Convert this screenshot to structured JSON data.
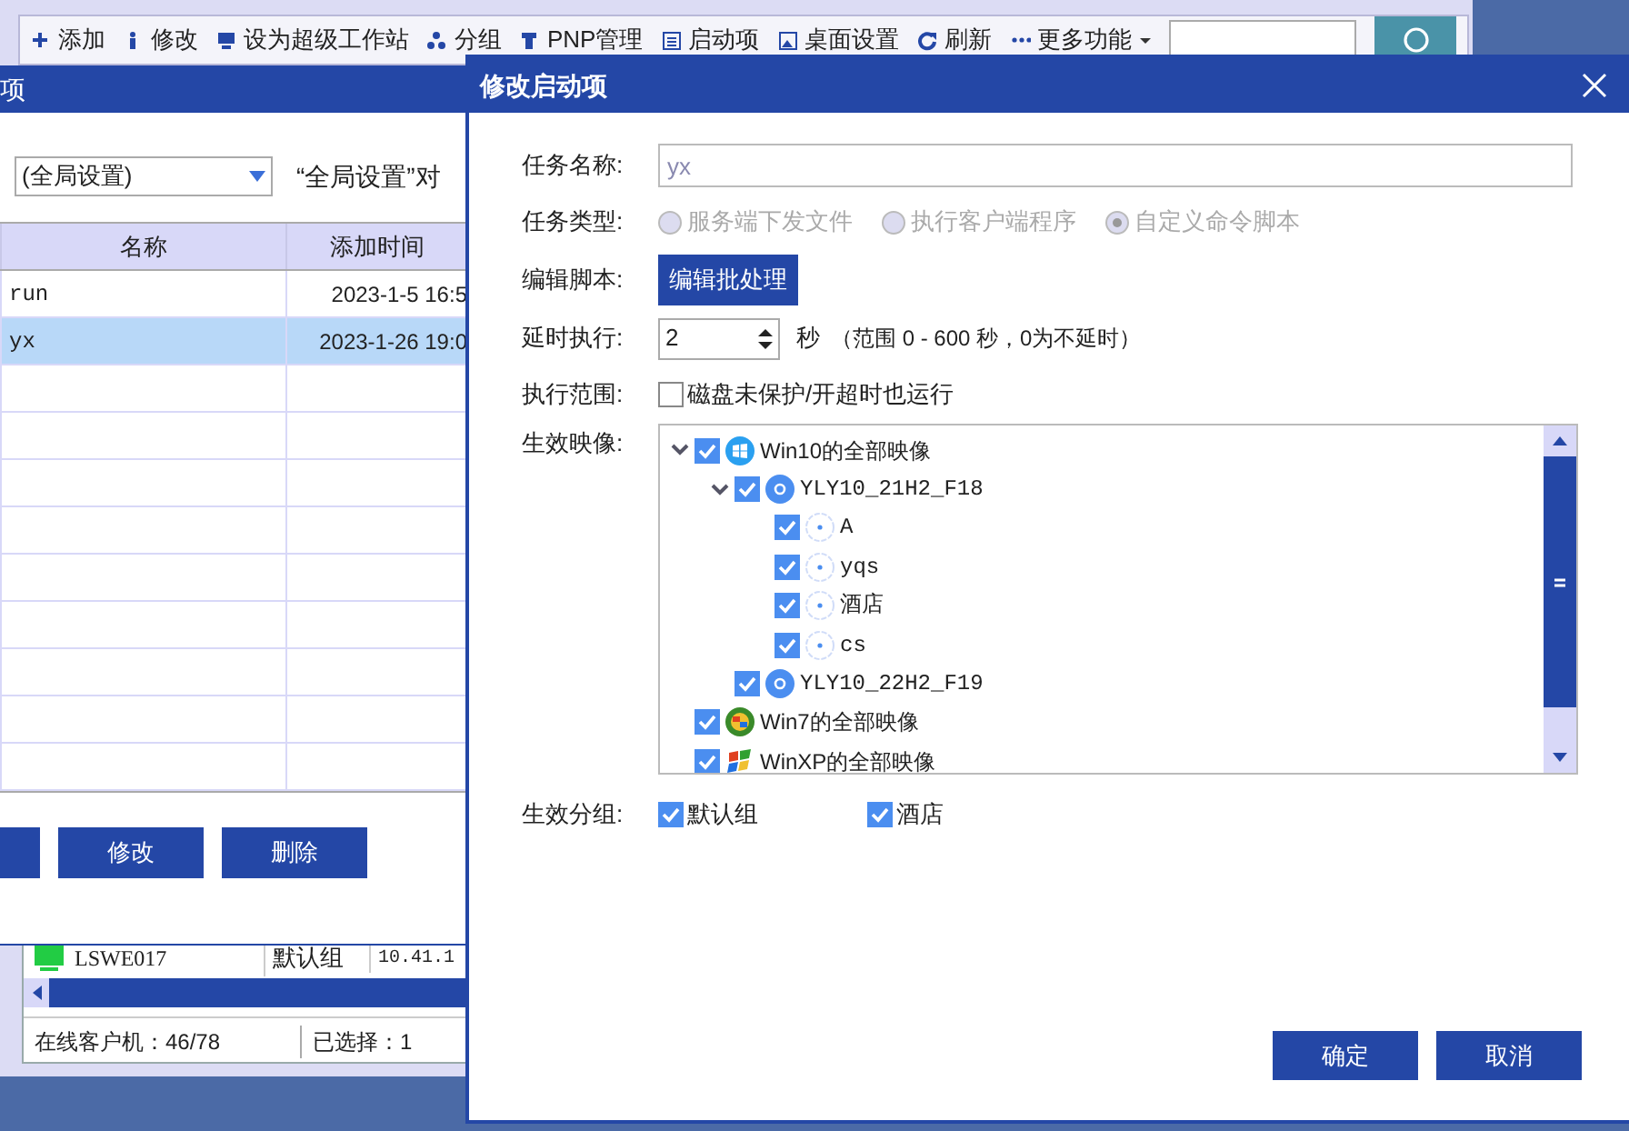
{
  "toolbar": {
    "items": [
      {
        "label": "添加"
      },
      {
        "label": "修改"
      },
      {
        "label": "设为超级工作站"
      },
      {
        "label": "分组"
      },
      {
        "label": "PNP管理"
      },
      {
        "label": "启动项"
      },
      {
        "label": "桌面设置"
      },
      {
        "label": "刷新"
      },
      {
        "label": "更多功能"
      }
    ]
  },
  "background_window": {
    "client_row": {
      "name": "LSWE017",
      "group": "默认组",
      "ip": "10.41.1"
    },
    "status_bar": [
      "在线客户机：46/78",
      "已选择：1"
    ]
  },
  "startup_window": {
    "title": "项",
    "scope_select": "(全局设置)",
    "note": "“全局设置”对",
    "table": {
      "columns": [
        "名称",
        "添加时间"
      ],
      "rows": [
        {
          "cells": [
            "run",
            "2023-1-5 16:5"
          ],
          "selected": false
        },
        {
          "cells": [
            "yx",
            "2023-1-26 19:0"
          ],
          "selected": true
        }
      ]
    },
    "buttons": [
      "修改",
      "删除"
    ]
  },
  "dialog": {
    "title": "修改启动项",
    "name_label": "任务名称:",
    "name_value": "yx",
    "type_label": "任务类型:",
    "types": [
      {
        "label": "服务端下发文件",
        "selected": false,
        "disabled": true
      },
      {
        "label": "执行客户端程序",
        "selected": false,
        "disabled": true
      },
      {
        "label": "自定义命令脚本",
        "selected": true,
        "disabled": true
      }
    ],
    "script_label": "编辑脚本:",
    "script_button": "编辑批处理",
    "delay_label": "延时执行:",
    "delay_value": "2",
    "delay_unit": "秒",
    "delay_hint": "（范围 0 - 600 秒，0为不延时）",
    "scope_label": "执行范围:",
    "scope_option": {
      "label": "磁盘未保护/开超时也运行",
      "checked": false
    },
    "images_label": "生效映像:",
    "images": [
      {
        "label": "Win10的全部映像",
        "kind": "os",
        "checked": true,
        "expanded": true,
        "children": [
          {
            "label": "YLY10_21H2_F18",
            "kind": "image",
            "checked": true,
            "expanded": true,
            "children": [
              {
                "label": "A",
                "kind": "version",
                "checked": true
              },
              {
                "label": "yqs",
                "kind": "version",
                "checked": true
              },
              {
                "label": "酒店",
                "kind": "version",
                "checked": true
              },
              {
                "label": "cs",
                "kind": "version",
                "checked": true
              }
            ]
          },
          {
            "label": "YLY10_22H2_F19",
            "kind": "image",
            "checked": true
          }
        ]
      },
      {
        "label": "Win7的全部映像",
        "kind": "os",
        "checked": true
      },
      {
        "label": "WinXP的全部映像",
        "kind": "os",
        "checked": true
      }
    ],
    "groups_label": "生效分组:",
    "groups": [
      {
        "label": "默认组",
        "checked": true
      },
      {
        "label": "酒店",
        "checked": true
      }
    ],
    "buttons": [
      "确定",
      "取消"
    ]
  }
}
